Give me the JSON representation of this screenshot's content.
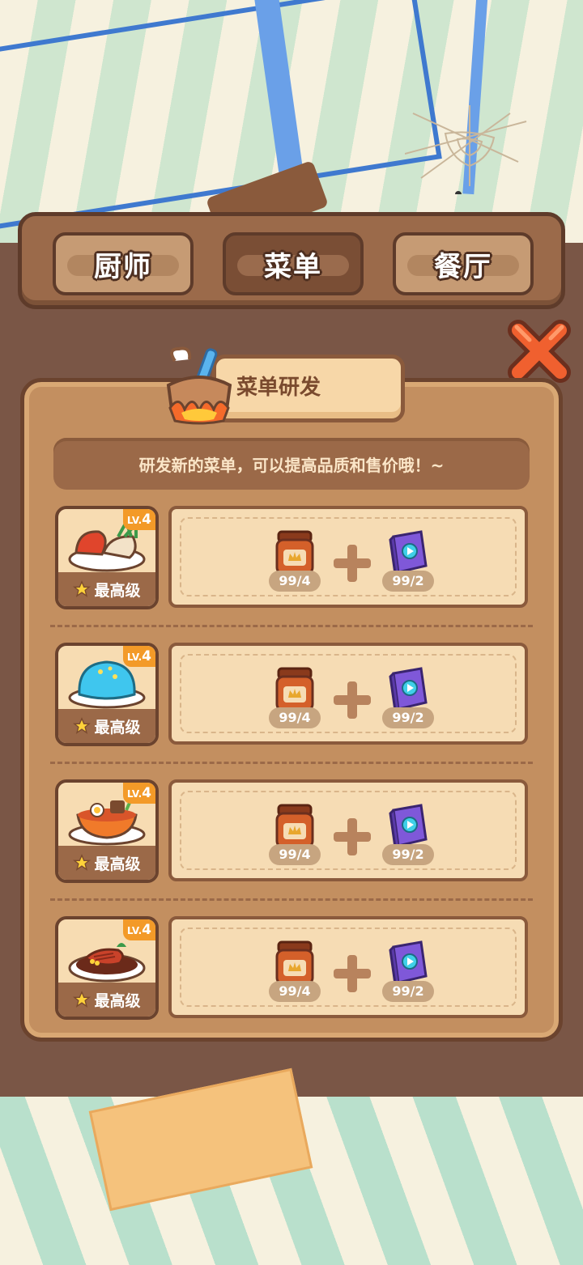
{
  "tabs": [
    {
      "label": "厨师",
      "active": false
    },
    {
      "label": "菜单",
      "active": true
    },
    {
      "label": "餐厅",
      "active": false
    }
  ],
  "panel": {
    "title": "菜单研发",
    "description": "研发新的菜单，可以提高品质和售价哦！~"
  },
  "dishes": [
    {
      "level_prefix": "LV.",
      "level": "4",
      "grade_label": "最高级",
      "dish_icon": "seafood-platter-icon",
      "ingredient1": {
        "icon": "sauce-jar-icon",
        "count": "99/4"
      },
      "ingredient2": {
        "icon": "recipe-book-icon",
        "count": "99/2"
      }
    },
    {
      "level_prefix": "LV.",
      "level": "4",
      "grade_label": "最高级",
      "dish_icon": "blue-jelly-icon",
      "ingredient1": {
        "icon": "sauce-jar-icon",
        "count": "99/4"
      },
      "ingredient2": {
        "icon": "recipe-book-icon",
        "count": "99/2"
      }
    },
    {
      "level_prefix": "LV.",
      "level": "4",
      "grade_label": "最高级",
      "dish_icon": "ramen-bowl-icon",
      "ingredient1": {
        "icon": "sauce-jar-icon",
        "count": "99/4"
      },
      "ingredient2": {
        "icon": "recipe-book-icon",
        "count": "99/2"
      }
    },
    {
      "level_prefix": "LV.",
      "level": "4",
      "grade_label": "最高级",
      "dish_icon": "steak-plate-icon",
      "ingredient1": {
        "icon": "sauce-jar-icon",
        "count": "99/4"
      },
      "ingredient2": {
        "icon": "recipe-book-icon",
        "count": "99/2"
      }
    }
  ],
  "colors": {
    "accent_orange": "#f39a28",
    "wood_dark": "#6b432e",
    "close_red": "#e8502a"
  }
}
